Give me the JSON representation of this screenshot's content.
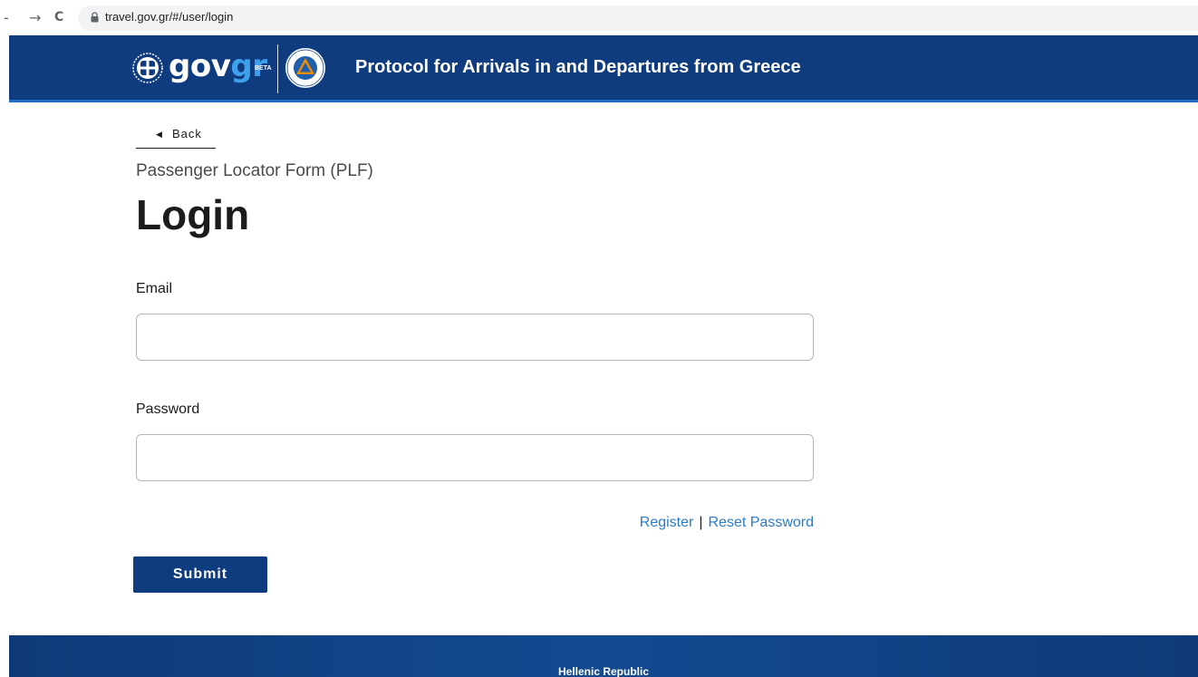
{
  "browser": {
    "back_glyph": "-",
    "forward_glyph": "→",
    "reload_glyph": "C",
    "url": "travel.gov.gr/#/user/login",
    "icons": [
      "lock-icon",
      "reload-icon",
      "forward-arrow-icon"
    ]
  },
  "header": {
    "brand_gov": "gov",
    "brand_gr": "gr",
    "beta": "BETA",
    "title": "Protocol for Arrivals in and Departures from Greece",
    "colors": {
      "background": "#0f3b7f",
      "accent": "#3fa0ec"
    },
    "icons": [
      "greek-emblem-icon",
      "civil-protection-icon"
    ]
  },
  "main": {
    "back_label": "Back",
    "form_caption": "Passenger Locator Form (PLF)",
    "title": "Login",
    "email": {
      "label": "Email",
      "value": "",
      "placeholder": ""
    },
    "password": {
      "label": "Password",
      "value": "",
      "placeholder": ""
    },
    "links": {
      "register": "Register",
      "separator": "|",
      "reset_password": "Reset Password"
    },
    "submit_label": "Submit",
    "colors": {
      "link": "#2a7ac7",
      "button": "#0f3b7f"
    }
  },
  "footer": {
    "text": "Hellenic Republic"
  }
}
